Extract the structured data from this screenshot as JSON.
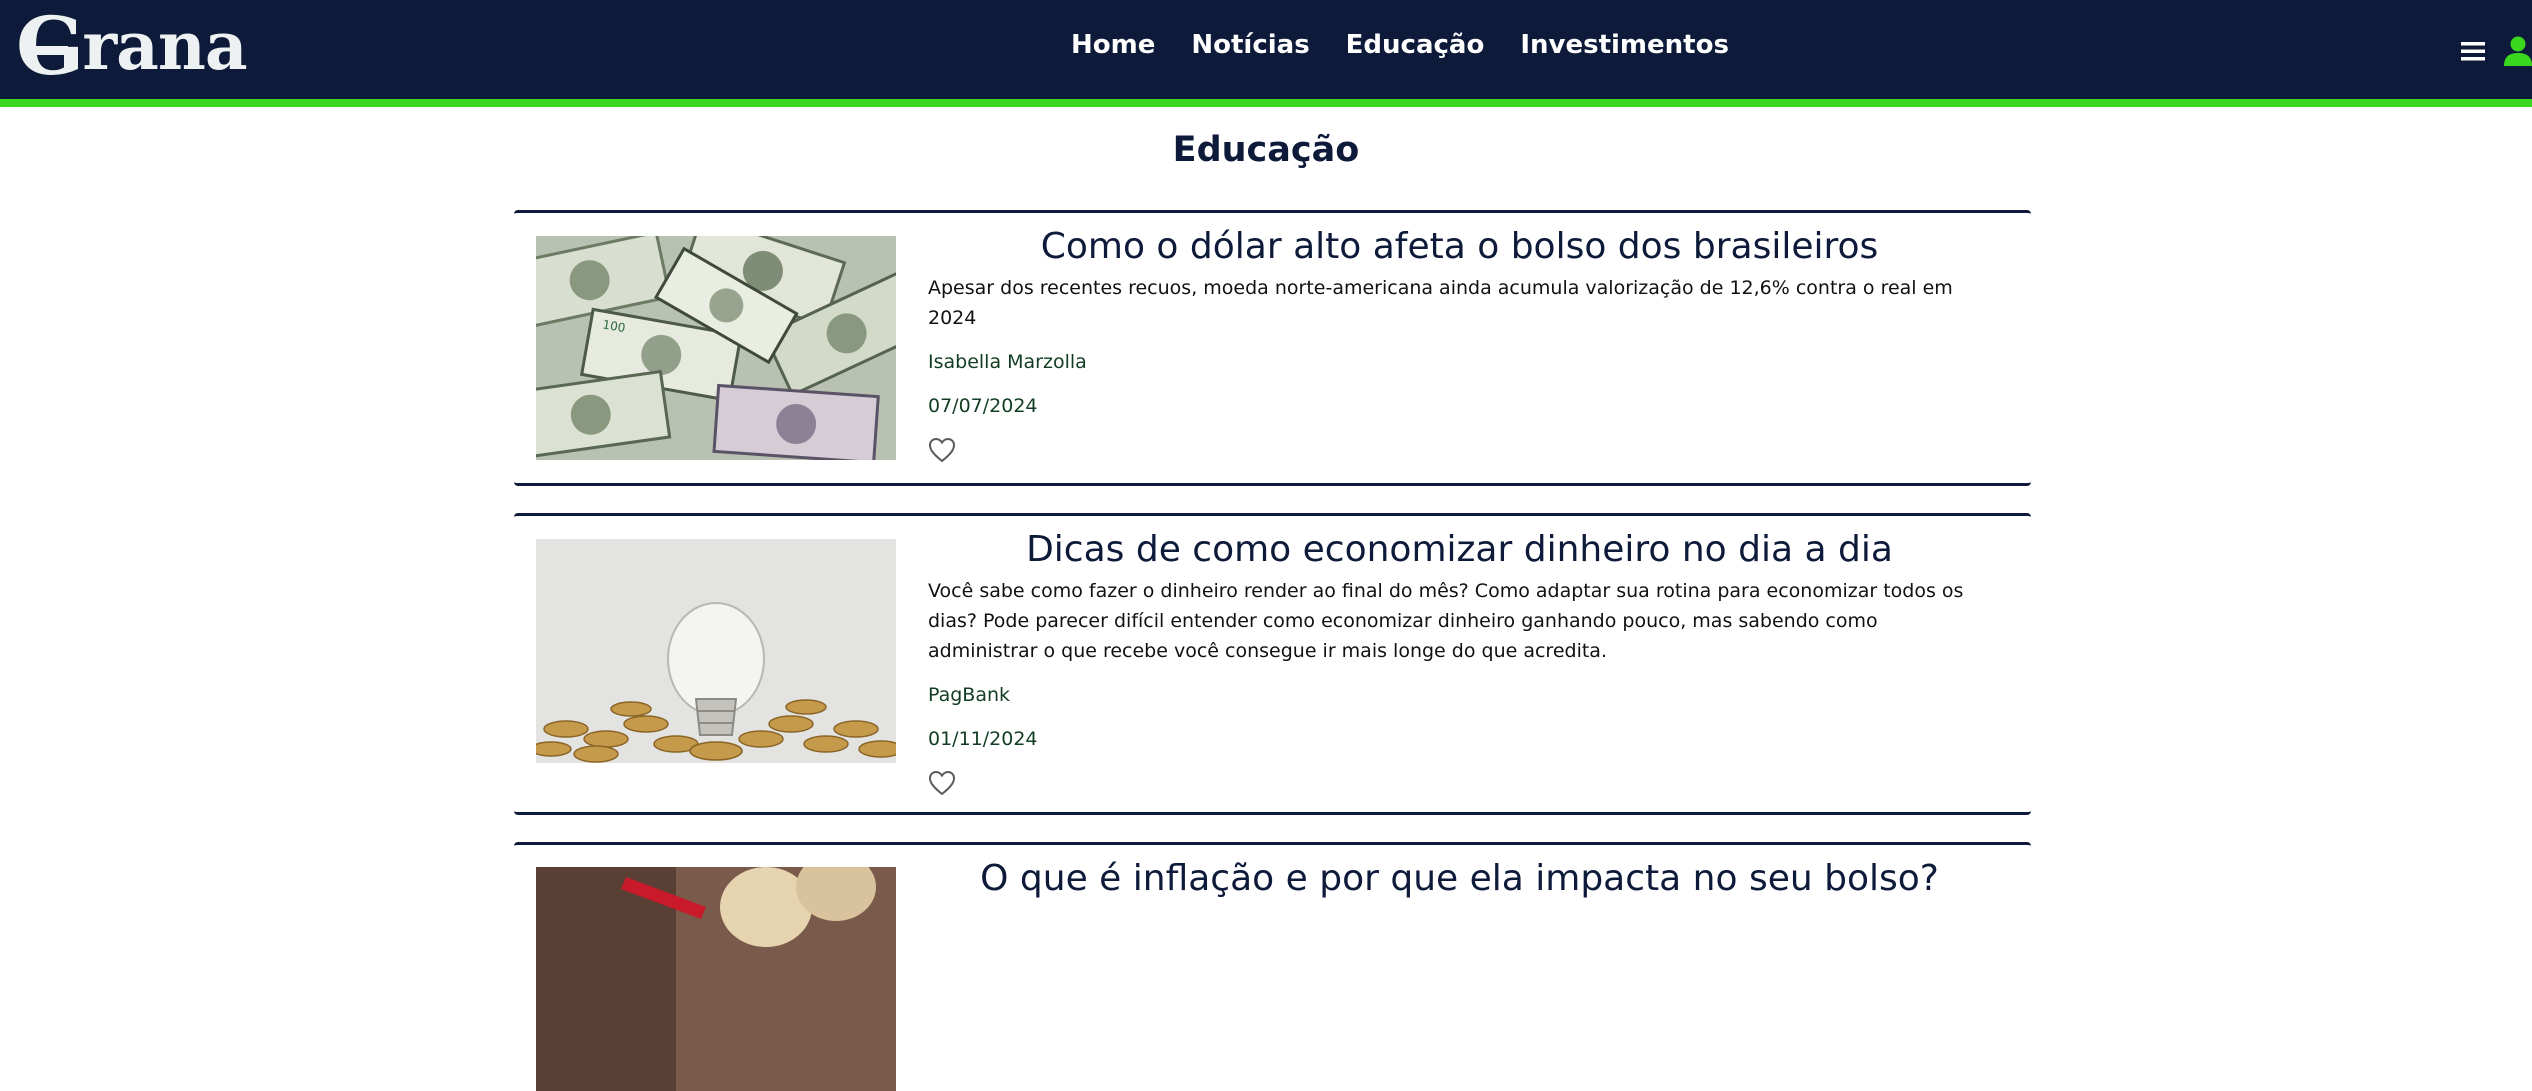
{
  "brand": {
    "logo_letter": "G",
    "logo_rest": "rana",
    "accent_color": "#3bd61f",
    "nav_bg": "#0d1a3a"
  },
  "nav": {
    "links": [
      "Home",
      "Notícias",
      "Educação",
      "Investimentos"
    ],
    "icons": [
      "menu-icon",
      "user-icon"
    ]
  },
  "page": {
    "title": "Educação"
  },
  "articles": [
    {
      "title": "Como o dólar alto afeta o bolso dos brasileiros",
      "description": "Apesar dos recentes recuos, moeda norte-americana ainda acumula valorização de 12,6% contra o real em 2024",
      "author": "Isabella Marzolla",
      "date": "07/07/2024",
      "image": "dollar-bills-image",
      "liked": false
    },
    {
      "title": "Dicas de como economizar dinheiro no dia a dia",
      "description": "Você sabe como fazer o dinheiro render ao final do mês? Como adaptar sua rotina para economizar todos os dias? Pode parecer difícil entender como economizar dinheiro ganhando pouco, mas sabendo como administrar o que recebe você consegue ir mais longe do que acredita.",
      "author": "PagBank",
      "date": "01/11/2024",
      "image": "lightbulb-coins-image",
      "liked": false
    },
    {
      "title": "O que é inflação e por que ela impacta no seu bolso?",
      "image": "inflation-image"
    }
  ]
}
